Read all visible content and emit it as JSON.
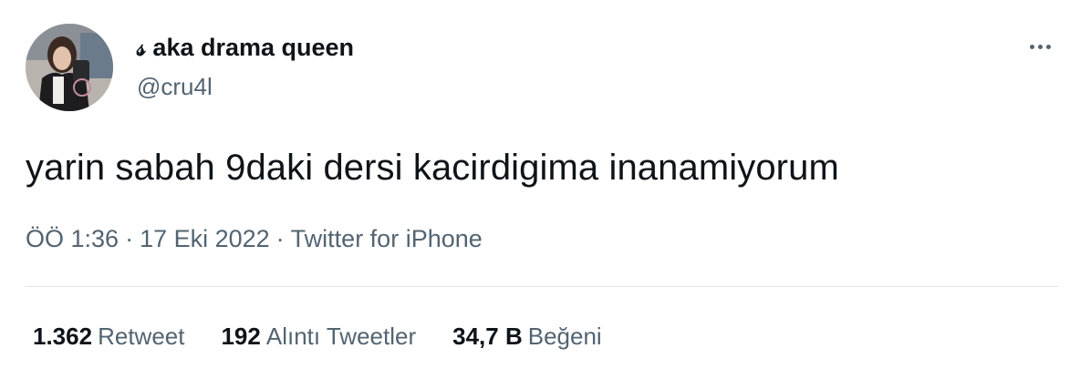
{
  "author": {
    "display_name": "𝓈 aka drama queen",
    "handle": "@cru4l"
  },
  "tweet": {
    "text": "yarin sabah 9daki dersi kacirdigima inanamiyorum",
    "time": "ÖÖ 1:36",
    "separator": "·",
    "date": "17 Eki 2022",
    "source": "Twitter for iPhone"
  },
  "stats": {
    "retweets_count": "1.362",
    "retweets_label": "Retweet",
    "quotes_count": "192",
    "quotes_label": "Alıntı Tweetler",
    "likes_count": "34,7 B",
    "likes_label": "Beğeni"
  },
  "icons": {
    "more": "more-horizontal-icon"
  },
  "colors": {
    "text_primary": "#0f1419",
    "text_secondary": "#536471",
    "divider": "#e3e7ea"
  }
}
